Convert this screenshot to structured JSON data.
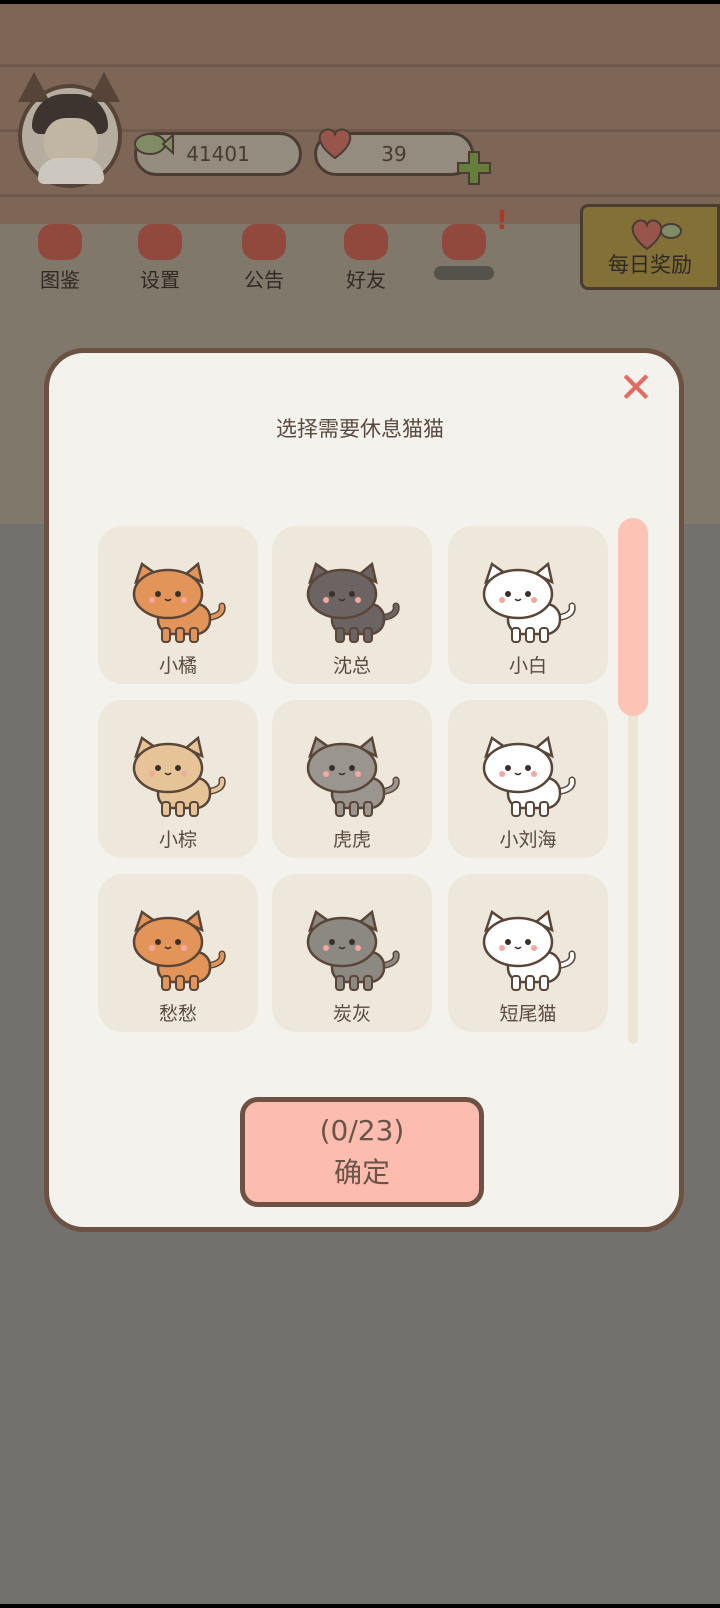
{
  "hud": {
    "fish_count": "41401",
    "heart_count": "39"
  },
  "menu": [
    {
      "label": "图鉴",
      "icon": "cat-face-icon"
    },
    {
      "label": "设置",
      "icon": "gear-icon"
    },
    {
      "label": "公告",
      "icon": "gift-icon"
    },
    {
      "label": "好友",
      "icon": "friends-icon"
    },
    {
      "label": "",
      "icon": "heart-fish-icon"
    }
  ],
  "daily_reward": {
    "label": "每日奖励"
  },
  "dialog": {
    "title": "选择需要休息猫猫",
    "close_symbol": "✕",
    "confirm_count": "(0/23)",
    "confirm_label": "确定",
    "cats": [
      {
        "name": "小橘",
        "color": "#e39458"
      },
      {
        "name": "沈总",
        "color": "#6b6463"
      },
      {
        "name": "小白",
        "color": "#ffffff"
      },
      {
        "name": "小棕",
        "color": "#e6c497"
      },
      {
        "name": "虎虎",
        "color": "#9b9590"
      },
      {
        "name": "小刘海",
        "color": "#ffffff"
      },
      {
        "name": "愁愁",
        "color": "#e39458"
      },
      {
        "name": "炭灰",
        "color": "#8c8882"
      },
      {
        "name": "短尾猫",
        "color": "#ffffff"
      }
    ]
  },
  "colors": {
    "accent": "#fcbcaf",
    "close": "#e36b61",
    "border": "#6d5142"
  }
}
